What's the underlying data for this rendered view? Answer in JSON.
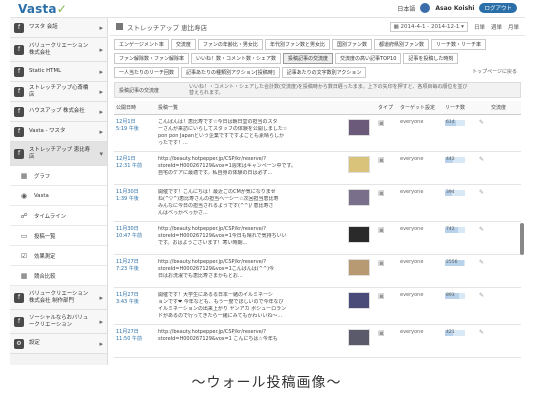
{
  "app": {
    "logo_main": "Vasta",
    "logo_accent": "✓"
  },
  "topbar": {
    "lang": "日本語",
    "username": "Asao Koishi",
    "logout": "ログアウト"
  },
  "sidebar": {
    "items": [
      {
        "label": "ワスタ 会話",
        "icon": "f",
        "arrow": "▸"
      },
      {
        "label": "バリュークリエーション 株式会社",
        "icon": "f",
        "arrow": "▸"
      },
      {
        "label": "Static HTML",
        "icon": "f",
        "arrow": "▸"
      },
      {
        "label": "ストレッチアップ心斎橋店",
        "icon": "f",
        "arrow": "▸"
      },
      {
        "label": "ハウスアップ 株式会社",
        "icon": "f",
        "arrow": "▸"
      },
      {
        "label": "Vasta - ワスタ",
        "icon": "f",
        "arrow": "▸"
      },
      {
        "label": "ストレッチアップ 恵比寿店",
        "icon": "f",
        "arrow": "▾"
      }
    ],
    "subitems": [
      {
        "label": "グラフ",
        "icon": "▦"
      },
      {
        "label": "Vasta",
        "icon": "◉"
      },
      {
        "label": "タイムライン",
        "icon": "☍"
      },
      {
        "label": "投稿一覧",
        "icon": "▭"
      },
      {
        "label": "効果測定",
        "icon": "☑"
      },
      {
        "label": "競合比較",
        "icon": "▦"
      }
    ],
    "bottom": [
      {
        "label": "バリュークリエーション 株式会社 制作部門",
        "icon": "f",
        "arrow": "▸"
      },
      {
        "label": "ソーシャルならおバリュークリエーション",
        "icon": "f",
        "arrow": "▸"
      },
      {
        "label": "設定",
        "icon": "⚙",
        "arrow": "▸"
      }
    ]
  },
  "main": {
    "title": "ストレッチアップ 恵比寿店",
    "date_range": "2014-4-1 - 2014-12-1",
    "date_unit_day": "日単",
    "date_unit_week": "週単",
    "date_unit_month": "月単",
    "tabs_row1": [
      "エンゲージメント率",
      "交流度",
      "ファンの年齢比・男女比",
      "年代別ファン数と男女比",
      "国別ファン数",
      "都道府県別ファン数",
      "リーチ数・リーチ率"
    ],
    "tabs_row2": [
      "ファン解除数・ファン解除率",
      "いいね！数・コメント数・シェア数",
      "投稿記事の交流度",
      "交流度の高い記事TOP10",
      "記事を投稿した時刻"
    ],
    "tabs_row3": [
      "一人当たりのリーチ回数",
      "記事あたりの種類別アクション[投稿時]",
      "記事あたりの文字数別アクション"
    ],
    "tabs_row3_right": "トップページに戻る",
    "notice_title": "投稿記事の交流度",
    "notice_text": "いいね！・コメント・シェアした合計数(交流度)を投稿時から数日経ったまま。上下の矢印を押すと、各項目毎の順位を並び替えられます。",
    "columns": [
      "公開日時",
      "投稿一覧",
      "",
      "タイプ",
      "ターゲット設定",
      "リーチ数",
      "",
      "交流度"
    ]
  },
  "posts": [
    {
      "date": "12月1日",
      "time": "5:19 午後",
      "lines": [
        "こんばんは！恵比寿です☆今日は朝日堂の担当のスタ",
        "ーさんが来訪にいらしてスタッフの体験を公開しました☆",
        "pon pon Japanという企業ですですよごとも素晴らしか",
        "ったです！..."
      ],
      "thumb": "#6b5a7a",
      "audience": "everyone",
      "reach": "614",
      "reach_frac": 0.55
    },
    {
      "date": "12月1日",
      "time": "12:31 午前",
      "lines": [
        "http://beauty.hotpepper.jp/CSP/kr/reserve/?",
        "storeId=H000267129&vos=1週末はキャンペーン中です。",
        "自宅のケアに最適です。私自身の体験の日は必ず..."
      ],
      "thumb": "#d9c27a",
      "audience": "everyone",
      "reach": "443",
      "reach_frac": 0.4
    },
    {
      "date": "11月30日",
      "time": "1:39 午後",
      "lines": [
        "開催です！こんにちは！最近ごのCMが気になりませ",
        "ね(^▽^)恵比寿さんの担当ヘーシー☆次回担当恵比寿",
        "みんなに今日の担当されるようです(^^)/ 恵比寿さ",
        "んはべっかべっかさ..."
      ],
      "thumb": "#7a6f8a",
      "audience": "everyone",
      "reach": "394",
      "reach_frac": 0.35
    },
    {
      "date": "11月30日",
      "time": "10:47 午前",
      "lines": [
        "http://beauty.hotpepper.jp/CSP/kr/reserve/?",
        "storeId=H000267129&vos=1今日も晴れで気持ちいい",
        "です。おはようございます！寒い時期..."
      ],
      "thumb": "#2a2a2a",
      "audience": "everyone",
      "reach": "742",
      "reach_frac": 0.65
    },
    {
      "date": "11月27日",
      "time": "7:23 午後",
      "lines": [
        "http://beauty.hotpepper.jp/CSP/kr/reserve/?",
        "storeId=H000267129&vos=1こんばんは(^^)今",
        "日はお洗濯でも恵比寿さまかもとお..."
      ],
      "thumb": "#b89a72",
      "audience": "everyone",
      "reach": "2556",
      "reach_frac": 0.95
    },
    {
      "date": "11月27日",
      "time": "3:43 午後",
      "lines": [
        "開催です！大学生にあるる日本ー緒のイルミネーシ",
        "ョンです❤ 今年なども、もう一度でほしいので今年なび",
        "イルミネーションの出来上がり ヤンアカ ポシューロラン",
        "ドがあるので行ってきたら一緒にみてもかわいいね〜..."
      ],
      "thumb": "#4b4b7a",
      "audience": "everyone",
      "reach": "893",
      "reach_frac": 0.7
    },
    {
      "date": "11月27日",
      "time": "11:50 午前",
      "lines": [
        "http://beauty.hotpepper.jp/CSP/kr/reserve/?",
        "storeId=H000267129&vos=1 こんにちは☆今年も"
      ],
      "thumb": "#5a5a6a",
      "audience": "everyone",
      "reach": "421",
      "reach_frac": 0.38
    }
  ],
  "caption": "〜ウォール投稿画像〜"
}
